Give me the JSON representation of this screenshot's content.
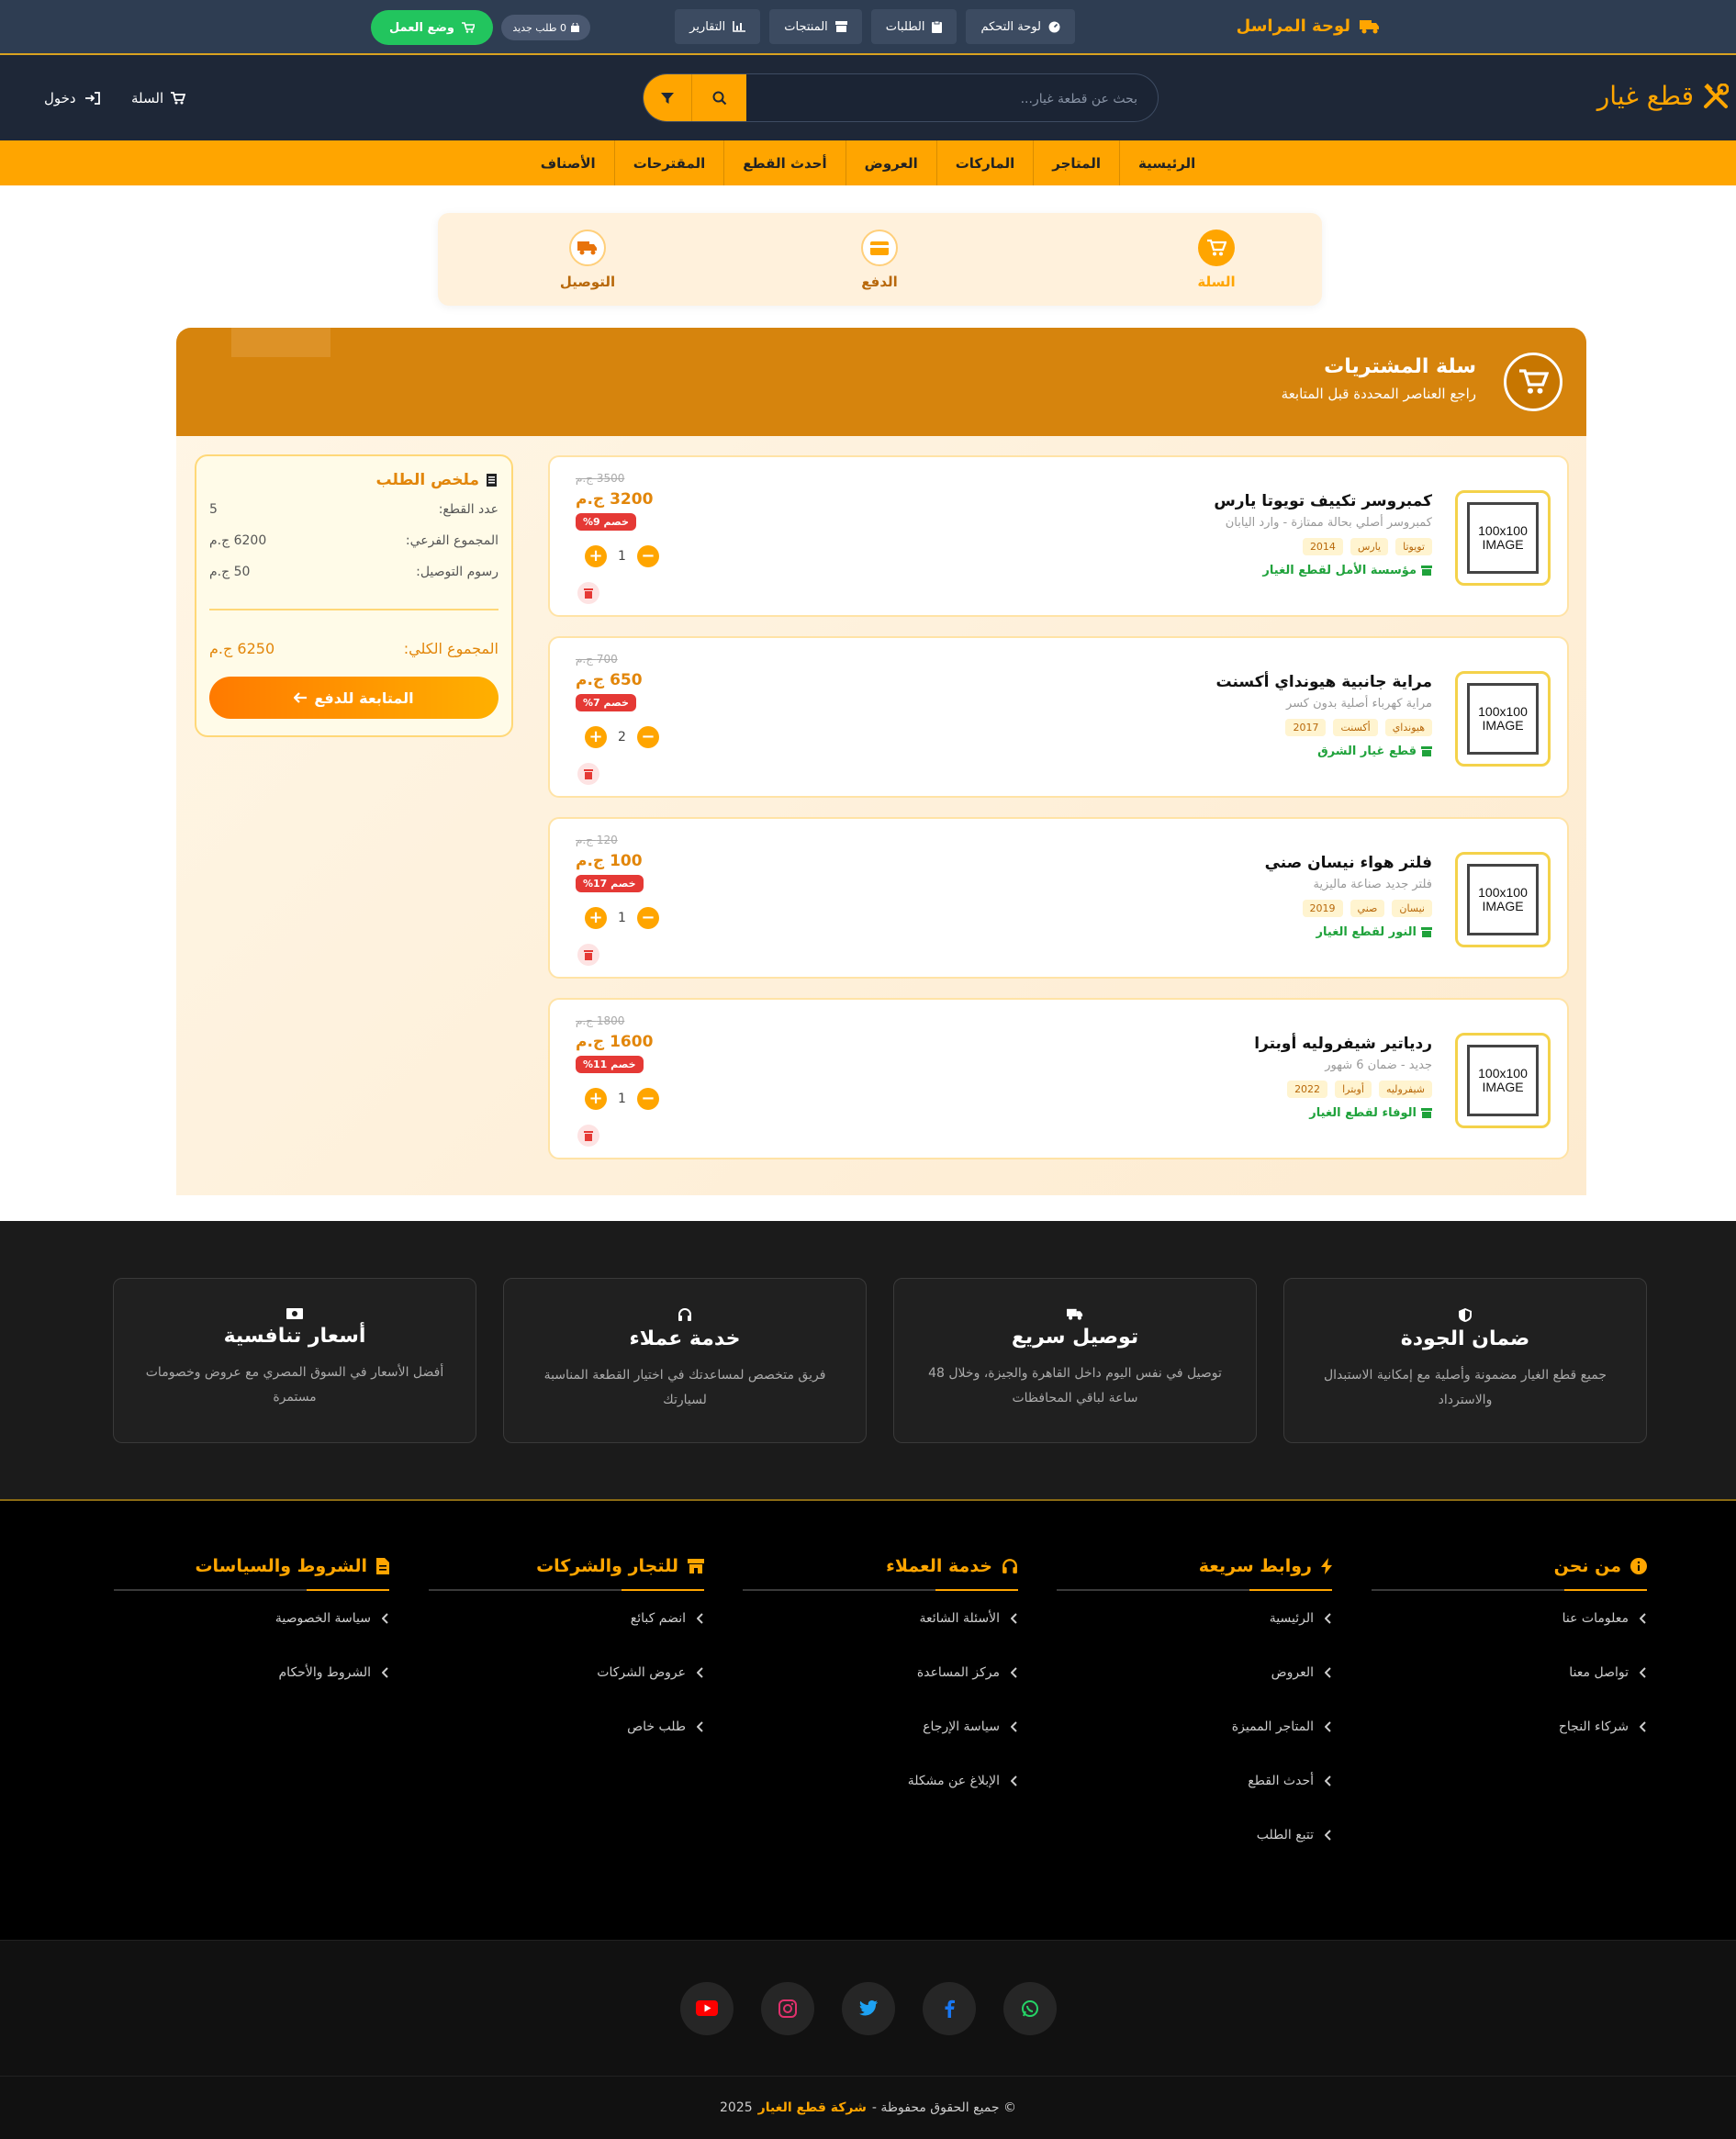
{
  "topbar": {
    "title": "لوحة المراسل",
    "dashboard": "لوحة التحكم",
    "orders": "الطلبات",
    "products": "المنتجات",
    "reports": "التقارير",
    "new_orders": "0 طلب جديد",
    "work_mode": "وضع العمل"
  },
  "header": {
    "logo": "قطع غيار",
    "search_placeholder": "بحث عن قطعة غيار...",
    "cart": "السلة",
    "login": "دخول"
  },
  "nav": [
    "الرئيسية",
    "المتاجر",
    "الماركات",
    "العروض",
    "أحدث القطع",
    "المقترحات",
    "الأصناف"
  ],
  "steps": [
    "السلة",
    "الدفع",
    "التوصيل"
  ],
  "cart": {
    "title": "سلة المشتريات",
    "subtitle": "راجع العناصر المحددة قبل المتابعة",
    "thumb_text": "100x100 IMAGE",
    "items": [
      {
        "name": "كمبروسر تكييف تويوتا يارس",
        "desc": "كمبروسر أصلي بحالة ممتازة - وارد اليابان",
        "tags": [
          "تويوتا",
          "يارس",
          "2014"
        ],
        "store": "مؤسسة الأمل لقطع الغيار",
        "old_price": "3500 ج.م",
        "price": "3200 ج.م",
        "discount": "خصم 9%",
        "qty": "1"
      },
      {
        "name": "مراية جانبية هيونداي أكسنت",
        "desc": "مراية كهرباء أصلية بدون كسر",
        "tags": [
          "هيونداي",
          "أكسنت",
          "2017"
        ],
        "store": "قطع غيار الشرق",
        "old_price": "700 ج.م",
        "price": "650 ج.م",
        "discount": "خصم 7%",
        "qty": "2"
      },
      {
        "name": "فلتر هواء نيسان صني",
        "desc": "فلتر جديد صناعة ماليزية",
        "tags": [
          "نيسان",
          "صني",
          "2019"
        ],
        "store": "النور لقطع الغيار",
        "old_price": "120 ج.م",
        "price": "100 ج.م",
        "discount": "خصم 17%",
        "qty": "1"
      },
      {
        "name": "ردياتير شيفروليه أوبترا",
        "desc": "جديد - ضمان 6 شهور",
        "tags": [
          "شيفروليه",
          "أوبترا",
          "2022"
        ],
        "store": "الوفاء لقطع الغيار",
        "old_price": "1800 ج.م",
        "price": "1600 ج.م",
        "discount": "خصم 11%",
        "qty": "1"
      }
    ],
    "summary": {
      "title": "ملخص الطلب",
      "count_label": "عدد القطع:",
      "count": "5",
      "subtotal_label": "المجموع الفرعي:",
      "subtotal": "6200 ج.م",
      "shipping_label": "رسوم التوصيل:",
      "shipping": "50 ج.م",
      "total_label": "المجموع الكلي:",
      "total": "6250 ج.م",
      "checkout": "المتابعة للدفع"
    }
  },
  "features": [
    {
      "title": "ضمان الجودة",
      "desc": "جميع قطع الغيار مضمونة وأصلية مع إمكانية الاستبدال والاسترداد",
      "icon": "shield-icon"
    },
    {
      "title": "توصيل سريع",
      "desc": "توصيل في نفس اليوم داخل القاهرة والجيزة، وخلال 48 ساعة لباقي المحافظات",
      "icon": "truck-icon"
    },
    {
      "title": "خدمة عملاء",
      "desc": "فريق متخصص لمساعدتك في اختيار القطعة المناسبة لسيارتك",
      "icon": "headset-icon"
    },
    {
      "title": "أسعار تنافسية",
      "desc": "أفضل الأسعار في السوق المصري مع عروض وخصومات مستمرة",
      "icon": "money-icon"
    }
  ],
  "footer": {
    "columns": [
      {
        "title": "من نحن",
        "icon": "info-icon",
        "links": [
          "معلومات عنا",
          "تواصل معنا",
          "شركاء النجاح"
        ]
      },
      {
        "title": "روابط سريعة",
        "icon": "bolt-icon",
        "links": [
          "الرئيسية",
          "العروض",
          "المتاجر المميزة",
          "أحدث القطع",
          "تتبع الطلب"
        ]
      },
      {
        "title": "خدمة العملاء",
        "icon": "headset-icon",
        "links": [
          "الأسئلة الشائعة",
          "مركز المساعدة",
          "سياسة الإرجاع",
          "الإبلاغ عن مشكلة"
        ]
      },
      {
        "title": "للتجار والشركات",
        "icon": "store-icon",
        "links": [
          "انضم كبائع",
          "عروض الشركات",
          "طلب خاص"
        ]
      },
      {
        "title": "الشروط والسياسات",
        "icon": "file-icon",
        "links": [
          "سياسة الخصوصية",
          "الشروط والأحكام"
        ]
      }
    ],
    "copyright_prefix": "© جميع الحقوق محفوظة -",
    "company": "شركة قطع الغيار",
    "year": "2025"
  },
  "colors": {
    "accent": "#ffa500",
    "dark": "#1e2737",
    "topbar": "#2e3d52",
    "green": "#22c55e",
    "red": "#e53935"
  }
}
